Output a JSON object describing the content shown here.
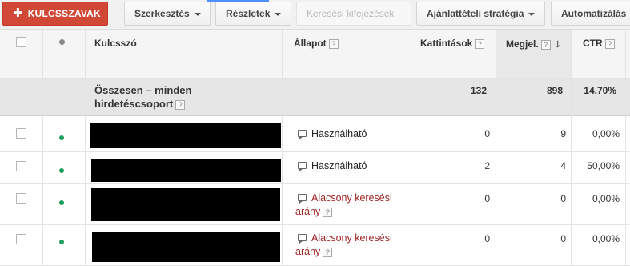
{
  "toolbar": {
    "add_keywords": "KULCSSZAVAK",
    "add_icon": "plus-icon",
    "edit": "Szerkesztés",
    "details": "Részletek",
    "search_terms": "Keresési kifejezések",
    "bid_strategy": "Ajánlattételi stratégia",
    "automate": "Automatizálás"
  },
  "columns": {
    "keyword": "Kulcsszó",
    "status": "Állapot",
    "clicks": "Kattintások",
    "impressions": "Megjel.",
    "ctr": "CTR",
    "help": "?",
    "sort_icon": "arrow-down-icon"
  },
  "total": {
    "label": "Összesen – minden hirdetéscsoport",
    "clicks": "132",
    "impressions": "898",
    "ctr": "14,70%"
  },
  "rows": [
    {
      "status": "Használható",
      "status_type": "ok",
      "clicks": "0",
      "impressions": "9",
      "ctr": "0,00%"
    },
    {
      "status": "Használható",
      "status_type": "ok",
      "clicks": "2",
      "impressions": "4",
      "ctr": "50,00%"
    },
    {
      "status_line1": "Alacsony keresési",
      "status_line2": "arány",
      "status_type": "low",
      "clicks": "0",
      "impressions": "0",
      "ctr": "0,00%"
    },
    {
      "status_line1": "Alacsony keresési",
      "status_line2": "arány",
      "status_type": "low",
      "clicks": "0",
      "impressions": "0",
      "ctr": "0,00%"
    }
  ],
  "colors": {
    "primary_button": "#d14836",
    "enabled_dot": "#1e9e5b",
    "low_status_text": "#a02626",
    "total_row_bg": "#e6e6e6"
  }
}
